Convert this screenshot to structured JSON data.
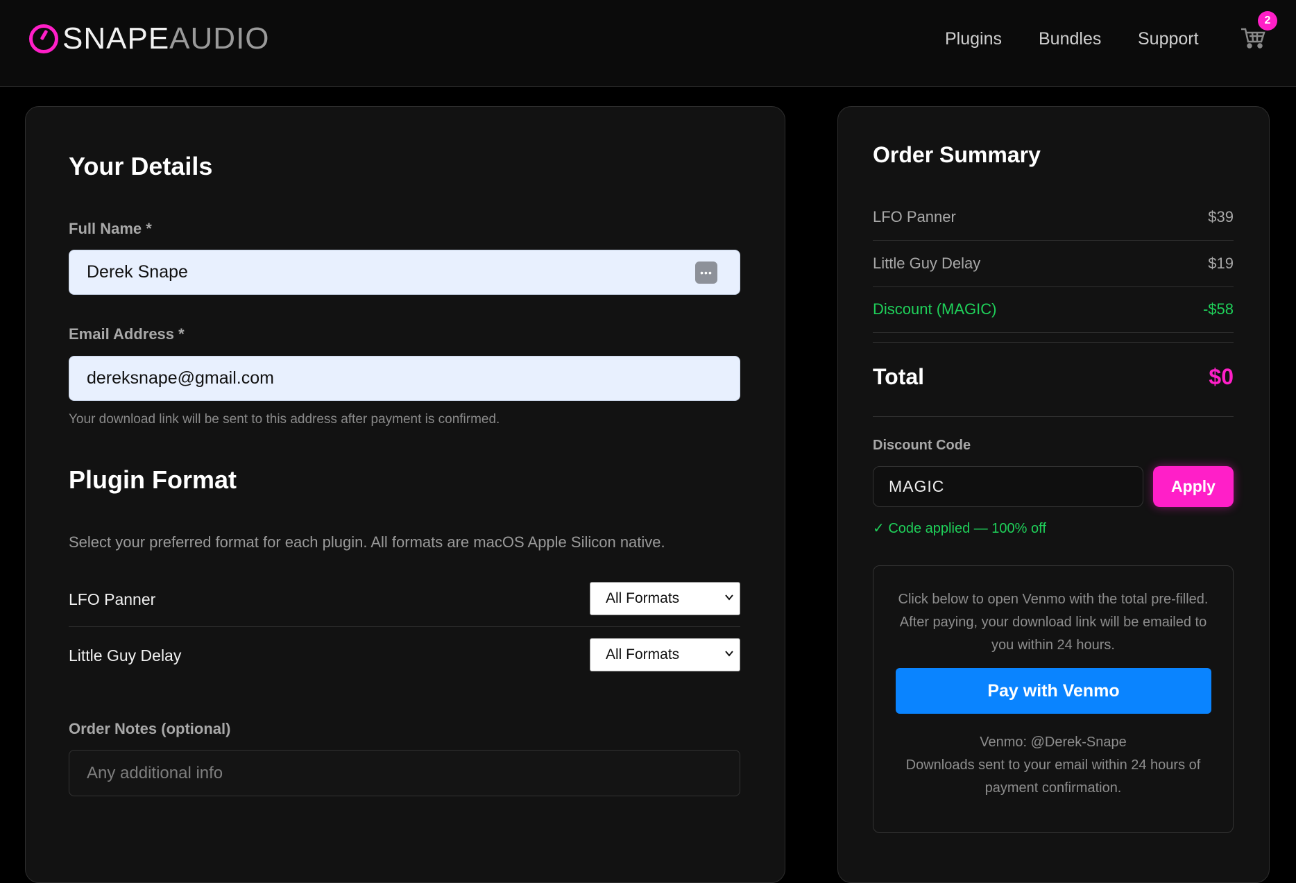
{
  "brand": {
    "name_primary": "SNAPE",
    "name_secondary": "AUDIO"
  },
  "nav": {
    "items": [
      {
        "label": "Plugins"
      },
      {
        "label": "Bundles"
      },
      {
        "label": "Support"
      }
    ]
  },
  "cart": {
    "count": "2"
  },
  "details": {
    "heading": "Your Details",
    "full_name": {
      "label": "Full Name *",
      "value": "Derek Snape"
    },
    "email": {
      "label": "Email Address *",
      "value": "dereksnape@gmail.com",
      "hint": "Your download link will be sent to this address after payment is confirmed."
    }
  },
  "format": {
    "heading": "Plugin Format",
    "description": "Select your preferred format for each plugin. All formats are macOS Apple Silicon native.",
    "rows": [
      {
        "plugin": "LFO Panner",
        "selected": "All Formats"
      },
      {
        "plugin": "Little Guy Delay",
        "selected": "All Formats"
      }
    ]
  },
  "notes": {
    "label": "Order Notes (optional)",
    "placeholder": "Any additional info"
  },
  "summary": {
    "heading": "Order Summary",
    "items": [
      {
        "name": "LFO Panner",
        "price": "$39"
      },
      {
        "name": "Little Guy Delay",
        "price": "$19"
      }
    ],
    "discount": {
      "name": "Discount (MAGIC)",
      "amount": "-$58"
    },
    "total": {
      "label": "Total",
      "amount": "$0"
    },
    "discount_code": {
      "label": "Discount Code",
      "value": "MAGIC",
      "apply_label": "Apply",
      "status": "✓ Code applied — 100% off"
    },
    "venmo": {
      "instructions": "Click below to open Venmo with the total pre-filled. After paying, your download link will be emailed to you within 24 hours.",
      "button_label": "Pay with Venmo",
      "handle": "Venmo: @Derek-Snape",
      "footnote": "Downloads sent to your email within 24 hours of payment confirmation."
    }
  },
  "colors": {
    "accent": "#ff1fc8",
    "success": "#1fd15a",
    "venmo": "#0a84ff",
    "background": "#000000"
  }
}
